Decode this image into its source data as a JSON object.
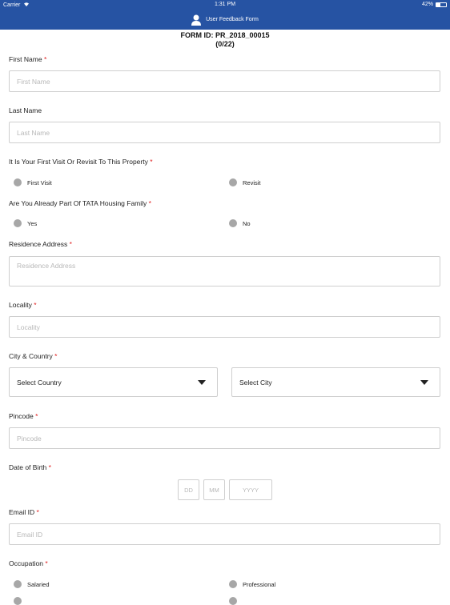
{
  "status_bar": {
    "carrier": "Carrier",
    "time": "1:31 PM",
    "battery": "42%",
    "battery_level": 0.42
  },
  "nav": {
    "title": "User Feedback Form",
    "icon": "user-icon"
  },
  "form": {
    "id_label": "FORM ID: PR_2018_00015",
    "progress": "(0/22)"
  },
  "fields": {
    "first_name": {
      "label": "First Name",
      "required": "*",
      "placeholder": "First Name"
    },
    "last_name": {
      "label": "Last Name",
      "placeholder": "Last Name"
    },
    "visit": {
      "label": "It Is Your First Visit Or Revisit To This Property",
      "required": "*",
      "options": [
        "First Visit",
        "Revisit"
      ]
    },
    "family": {
      "label": "Are You Already Part Of TATA Housing Family",
      "required": "*",
      "options": [
        "Yes",
        "No"
      ]
    },
    "residence": {
      "label": "Residence Address",
      "required": "*",
      "placeholder": "Residence Address"
    },
    "locality": {
      "label": "Locality",
      "required": "*",
      "placeholder": "Locality"
    },
    "city_country": {
      "label": "City & Country",
      "required": "*",
      "country_value": "Select Country",
      "city_value": "Select City"
    },
    "pincode": {
      "label": "Pincode",
      "required": "*",
      "placeholder": "Pincode"
    },
    "dob": {
      "label": "Date of Birth",
      "required": "*",
      "dd": "DD",
      "mm": "MM",
      "yyyy": "YYYY"
    },
    "email": {
      "label": "Email ID",
      "required": "*",
      "placeholder": "Email ID"
    },
    "occupation": {
      "label": "Occupation",
      "required": "*",
      "options": [
        "Salaried",
        "Professional"
      ]
    }
  },
  "colors": {
    "primary": "#2653a3",
    "required": "#e02020",
    "radio": "#a7a7a7"
  }
}
